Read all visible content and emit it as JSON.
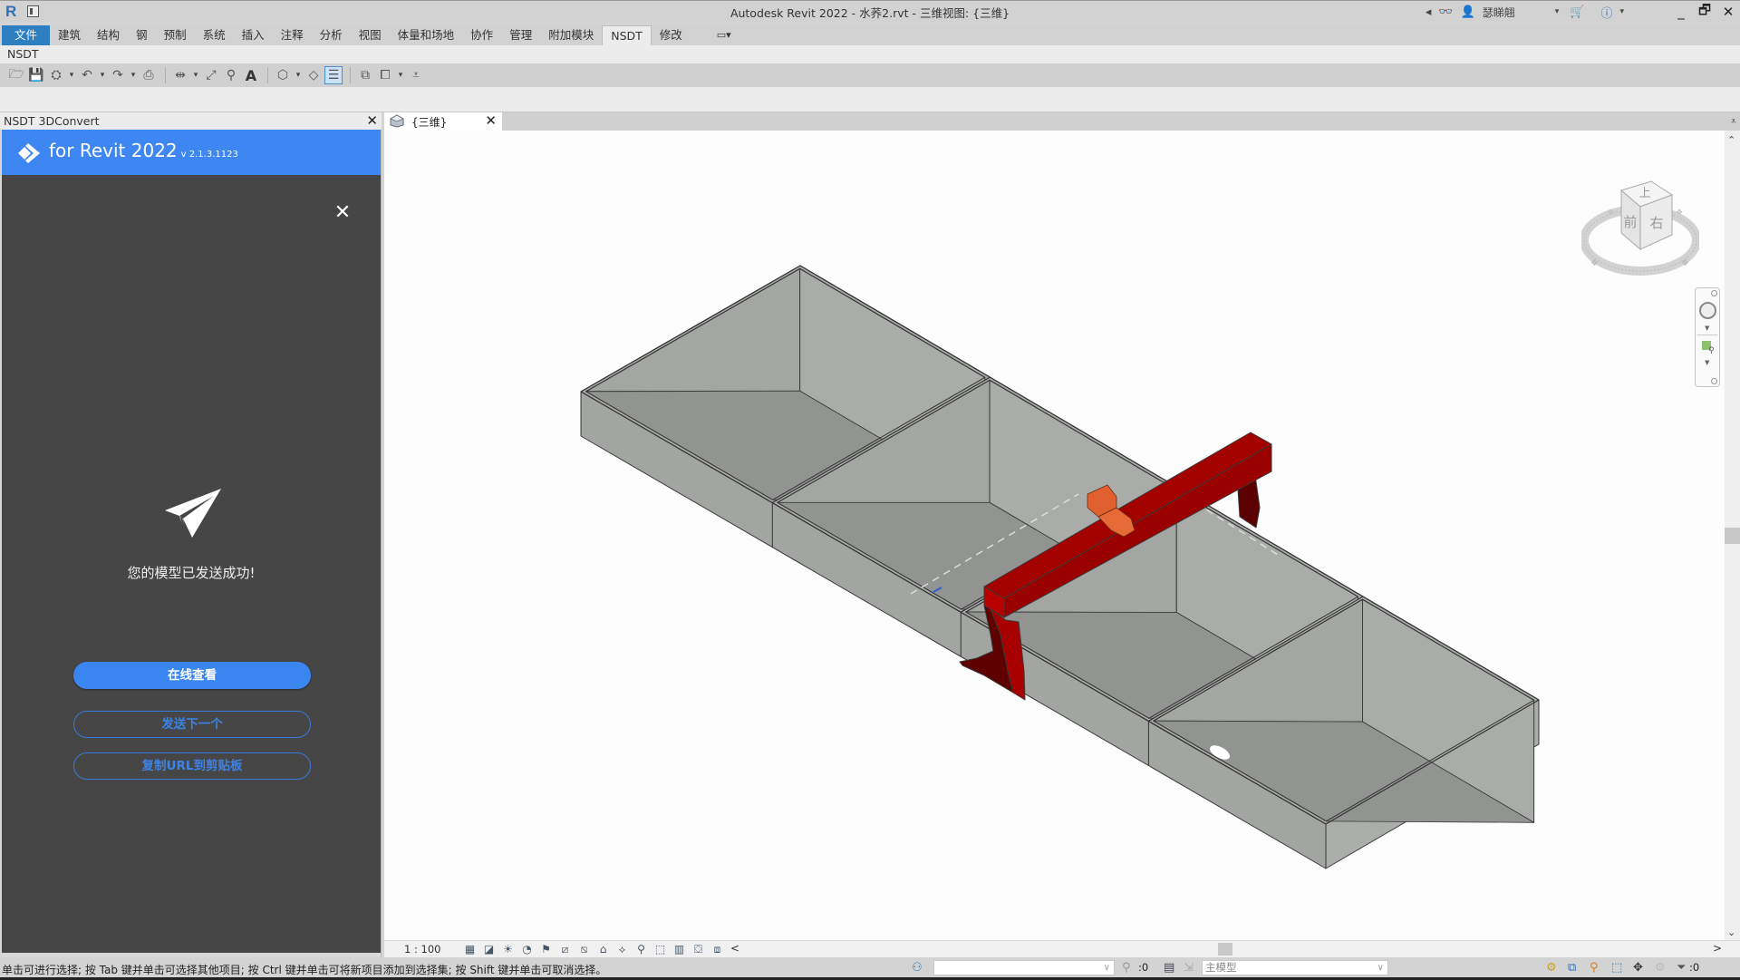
{
  "window": {
    "title": "Autodesk Revit 2022 - 水荞2.rvt - 三维视图: {三维}",
    "app_logo": "R",
    "user_name": "瑟睇翹",
    "icons": [
      "nav-back-icon",
      "binoculars-icon",
      "user-icon",
      "cart-icon",
      "help-icon"
    ],
    "controls": {
      "minimize": "_",
      "restore": "🗗",
      "close": "✕"
    }
  },
  "ribbon": {
    "tabs": [
      {
        "label": "文件",
        "type": "file"
      },
      {
        "label": "建筑"
      },
      {
        "label": "结构"
      },
      {
        "label": "钢"
      },
      {
        "label": "预制"
      },
      {
        "label": "系统"
      },
      {
        "label": "插入"
      },
      {
        "label": "注释"
      },
      {
        "label": "分析"
      },
      {
        "label": "视图"
      },
      {
        "label": "体量和场地"
      },
      {
        "label": "协作"
      },
      {
        "label": "管理"
      },
      {
        "label": "附加模块"
      },
      {
        "label": "NSDT",
        "active": true
      },
      {
        "label": "修改"
      },
      {
        "label": "▭▾",
        "type": "dropdown"
      }
    ],
    "panel_label": "NSDT"
  },
  "quick_access": [
    {
      "icon": "open-icon",
      "glyph": "🗁"
    },
    {
      "icon": "save-icon",
      "glyph": "💾"
    },
    {
      "icon": "sync-icon",
      "glyph": "⛭"
    },
    {
      "icon": "dropdown-icon",
      "glyph": "▾"
    },
    {
      "icon": "undo-icon",
      "glyph": "↶"
    },
    {
      "icon": "dropdown-icon",
      "glyph": "▾"
    },
    {
      "icon": "redo-icon",
      "glyph": "↷"
    },
    {
      "icon": "dropdown-icon",
      "glyph": "▾"
    },
    {
      "icon": "print-icon",
      "glyph": "⎙"
    },
    {
      "icon": "separator",
      "glyph": ""
    },
    {
      "icon": "measure-icon",
      "glyph": "⇹"
    },
    {
      "icon": "dropdown-icon",
      "glyph": "▾"
    },
    {
      "icon": "aligned-dimension-icon",
      "glyph": "⤢"
    },
    {
      "icon": "tag-icon",
      "glyph": "⚲"
    },
    {
      "icon": "text-icon",
      "glyph": "A"
    },
    {
      "icon": "separator",
      "glyph": ""
    },
    {
      "icon": "3d-view-icon",
      "glyph": "⬡"
    },
    {
      "icon": "dropdown-icon",
      "glyph": "▾"
    },
    {
      "icon": "section-icon",
      "glyph": "◇"
    },
    {
      "icon": "thin-lines-icon",
      "glyph": "☰",
      "selected": true
    },
    {
      "icon": "separator",
      "glyph": ""
    },
    {
      "icon": "close-hidden-icon",
      "glyph": "⧉"
    },
    {
      "icon": "switch-windows-icon",
      "glyph": "⧠"
    },
    {
      "icon": "dropdown-icon",
      "glyph": "▾"
    },
    {
      "icon": "customize-icon",
      "glyph": "⩡"
    }
  ],
  "plugin_panel": {
    "title": "NSDT 3DConvert",
    "close": "✕",
    "banner_title": "for Revit 2022",
    "banner_version": "v 2.1.3.1123",
    "dialog_close": "✕",
    "success_message": "您的模型已发送成功!",
    "buttons": {
      "view_online": "在线查看",
      "send_next": "发送下一个",
      "copy_url": "复制URL到剪贴板"
    },
    "colors": {
      "accent": "#3e86f1",
      "body": "#464646"
    }
  },
  "view": {
    "tab_label": "{三维}",
    "tab_close": "✕",
    "tab_menu": "⩡",
    "viewcube": {
      "top": "上",
      "front": "前",
      "right": "右"
    },
    "model": {
      "walls_color": "#a3a6a2",
      "floor_color": "#909290",
      "crane_color": "#a30000",
      "trolley_color": "#e0612f"
    }
  },
  "view_control": {
    "scale": "1 : 100",
    "icons": [
      "detail-level-icon",
      "visual-style-icon",
      "sun-path-icon",
      "shadows-icon",
      "render-icon",
      "crop-view-icon",
      "show-crop-icon",
      "unlock-3d-icon",
      "temp-hide-icon",
      "reveal-hidden-icon",
      "analytical-icon",
      "highlight-displacement-icon",
      "reveal-constraints-icon",
      "worksharing-icon",
      "view-templates-icon"
    ],
    "icon_glyphs": [
      "▦",
      "◪",
      "☀",
      "◔",
      "⚑",
      "⧄",
      "⧅",
      "⌂",
      "⟡",
      "⚲",
      "⬚",
      "▥",
      "⛋",
      "⧈"
    ],
    "scroll_left": "<",
    "scroll_right": ">"
  },
  "statusbar": {
    "message": "单击可进行选择; 按 Tab 键并单击可选择其他项目; 按 Ctrl 键并单击可将新项目添加到选择集; 按 Shift 键并单击可取消选择。",
    "workset_value": "",
    "selection_count": ":0",
    "design_option": "主模型",
    "filter_count": ":0"
  }
}
